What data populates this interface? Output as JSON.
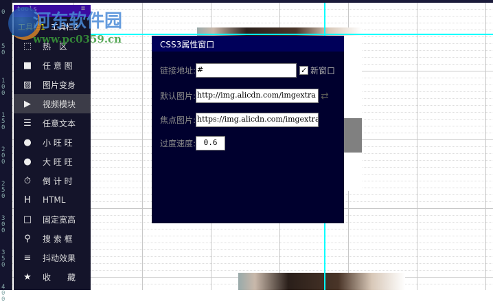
{
  "ruler": {
    "labels": [
      "0",
      "50",
      "100",
      "150",
      "200",
      "250",
      "300",
      "350",
      "400"
    ]
  },
  "watermark": {
    "title": "河东软件园",
    "url": "www.pc0359.cn"
  },
  "panel": {
    "title": "tools",
    "menu_icon": "≡",
    "tabs": [
      "工具栏1",
      "工具栏2"
    ],
    "items": [
      {
        "label": "热　区",
        "icon": "hotspot-icon"
      },
      {
        "label": "任 意 图",
        "icon": "image-block-icon"
      },
      {
        "label": "图片变身",
        "icon": "picture-icon"
      },
      {
        "label": "视频模块",
        "icon": "play-icon"
      },
      {
        "label": "任意文本",
        "icon": "text-icon"
      },
      {
        "label": "小 旺 旺",
        "icon": "wangwang-icon"
      },
      {
        "label": "大 旺 旺",
        "icon": "wangwang-icon"
      },
      {
        "label": "倒 计 时",
        "icon": "stopwatch-icon"
      },
      {
        "label": "HTML",
        "icon": "html-icon"
      },
      {
        "label": "固定宽高",
        "icon": "square-icon"
      },
      {
        "label": "搜 索 框",
        "icon": "search-icon"
      },
      {
        "label": "抖动效果",
        "icon": "list-icon"
      },
      {
        "label": "收　　藏",
        "icon": "star-icon"
      }
    ]
  },
  "dialog": {
    "title": "CSS3属性窗口",
    "link_label": "链接地址:",
    "link_value": "#",
    "new_window_label": "新窗口",
    "new_window_checked": true,
    "default_img_label": "默认图片:",
    "default_img_value": "http://img.alicdn.com/imgextra",
    "focus_img_label": "焦点图片:",
    "focus_img_value": "https://img.alicdn.com/imgextra",
    "speed_label": "过度速度:",
    "speed_value": "0.6"
  }
}
